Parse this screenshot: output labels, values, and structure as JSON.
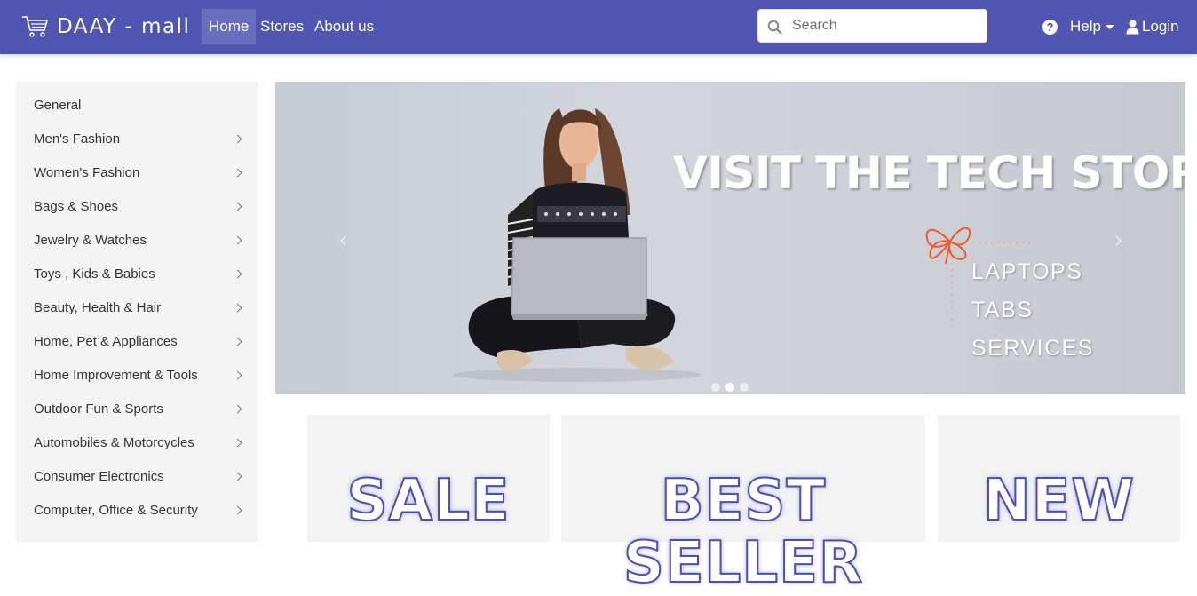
{
  "brand": {
    "name": "DAAY - mall",
    "icon": "shopping-cart-icon"
  },
  "nav": {
    "home": "Home",
    "stores": "Stores",
    "about": "About us"
  },
  "search": {
    "placeholder": "Search",
    "icon": "search-icon"
  },
  "help": {
    "label": "Help",
    "icon": "question-circle-icon"
  },
  "login": {
    "label": "Login",
    "icon": "user-icon"
  },
  "sidebar": {
    "items": [
      {
        "label": "General",
        "has_submenu": false
      },
      {
        "label": "Men's Fashion",
        "has_submenu": true
      },
      {
        "label": "Women's Fashion",
        "has_submenu": true
      },
      {
        "label": "Bags & Shoes",
        "has_submenu": true
      },
      {
        "label": "Jewelry & Watches",
        "has_submenu": true
      },
      {
        "label": "Toys , Kids & Babies",
        "has_submenu": true
      },
      {
        "label": "Beauty, Health & Hair",
        "has_submenu": true
      },
      {
        "label": "Home, Pet & Appliances",
        "has_submenu": true
      },
      {
        "label": "Home Improvement & Tools",
        "has_submenu": true
      },
      {
        "label": "Outdoor Fun & Sports",
        "has_submenu": true
      },
      {
        "label": "Automobiles & Motorcycles",
        "has_submenu": true
      },
      {
        "label": "Consumer Electronics",
        "has_submenu": true
      },
      {
        "label": "Computer, Office & Security",
        "has_submenu": true
      }
    ]
  },
  "carousel": {
    "title": "VISIT THE TECH STORE",
    "items": [
      "LAPTOPS",
      "TABS",
      "SERVICES"
    ],
    "slide_count": 3,
    "active_slide": 2
  },
  "promos": {
    "sale": "SALE",
    "best_seller": "BEST SELLER",
    "new": "NEW"
  },
  "colors": {
    "nav": "#5055b1",
    "sidebar": "#f4f4f4",
    "promo_text_outline": "#4b4fb0",
    "accent_flower": "#f05a28"
  }
}
